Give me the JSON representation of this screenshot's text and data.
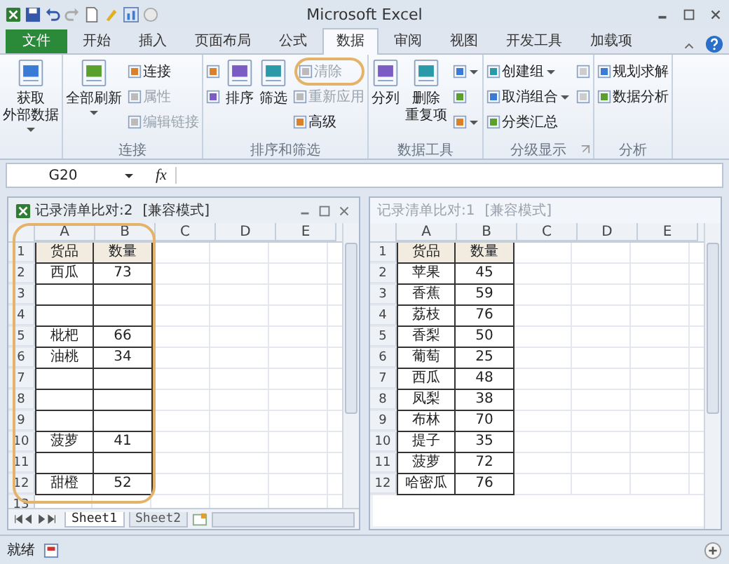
{
  "window": {
    "title": "Microsoft Excel"
  },
  "tabs": [
    {
      "label": "文件",
      "selected": false,
      "kind": "file"
    },
    {
      "label": "开始",
      "selected": false,
      "kind": "tab"
    },
    {
      "label": "插入",
      "selected": false,
      "kind": "tab"
    },
    {
      "label": "页面布局",
      "selected": false,
      "kind": "tab"
    },
    {
      "label": "公式",
      "selected": false,
      "kind": "tab"
    },
    {
      "label": "数据",
      "selected": true,
      "kind": "tab"
    },
    {
      "label": "审阅",
      "selected": false,
      "kind": "tab"
    },
    {
      "label": "视图",
      "selected": false,
      "kind": "tab"
    },
    {
      "label": "开发工具",
      "selected": false,
      "kind": "tab"
    },
    {
      "label": "加载项",
      "selected": false,
      "kind": "tab"
    }
  ],
  "ribbon": {
    "groups": [
      {
        "columns": [
          [
            {
              "kind": "large",
              "lines": [
                "获取",
                "外部数据"
              ],
              "dropdown": true,
              "disabled": false
            }
          ]
        ]
      },
      {
        "label": "连接",
        "columns": [
          [
            {
              "kind": "large",
              "lines": [
                "全部刷新"
              ],
              "dropdown": true,
              "disabled": false
            }
          ],
          [
            {
              "kind": "small",
              "label": "连接",
              "disabled": false
            },
            {
              "kind": "small",
              "label": "属性",
              "disabled": true
            },
            {
              "kind": "small",
              "label": "编辑链接",
              "disabled": true
            }
          ]
        ]
      },
      {
        "label": "排序和筛选",
        "columns": [
          [
            {
              "kind": "icon",
              "disabled": false
            },
            {
              "kind": "icon",
              "disabled": false
            }
          ],
          [
            {
              "kind": "large",
              "lines": [
                "排序"
              ],
              "disabled": false
            }
          ],
          [
            {
              "kind": "large",
              "lines": [
                "筛选"
              ],
              "disabled": false
            }
          ],
          [
            {
              "kind": "small",
              "label": "清除",
              "disabled": true,
              "circled": true
            },
            {
              "kind": "small",
              "label": "重新应用",
              "disabled": true
            },
            {
              "kind": "small",
              "label": "高级",
              "disabled": false
            }
          ]
        ]
      },
      {
        "label": "数据工具",
        "columns": [
          [
            {
              "kind": "large",
              "lines": [
                "分列"
              ],
              "disabled": false
            }
          ],
          [
            {
              "kind": "large",
              "lines": [
                "删除",
                "重复项"
              ],
              "disabled": false
            }
          ],
          [
            {
              "kind": "icon",
              "dropdown": true,
              "disabled": false
            },
            {
              "kind": "icon",
              "disabled": false
            },
            {
              "kind": "icon",
              "dropdown": true,
              "disabled": false
            }
          ]
        ]
      },
      {
        "label": "分级显示",
        "launcher": true,
        "columns": [
          [
            {
              "kind": "small",
              "label": "创建组",
              "dropdown": true,
              "disabled": false
            },
            {
              "kind": "small",
              "label": "取消组合",
              "dropdown": true,
              "disabled": false
            },
            {
              "kind": "small",
              "label": "分类汇总",
              "disabled": false
            }
          ],
          [
            {
              "kind": "icon",
              "disabled": true
            },
            {
              "kind": "icon",
              "disabled": true
            }
          ]
        ]
      },
      {
        "label": "分析",
        "columns": [
          [
            {
              "kind": "small",
              "label": "规划求解",
              "disabled": false
            },
            {
              "kind": "small",
              "label": "数据分析",
              "disabled": false
            }
          ]
        ]
      }
    ]
  },
  "formula_bar": {
    "name_box": "G20",
    "function_label": "fx"
  },
  "workbooks": [
    {
      "title": "记录清单比对:2",
      "mode": "[兼容模式]",
      "active": true,
      "circled": true,
      "columns": [
        "A",
        "B",
        "C",
        "D",
        "E"
      ],
      "rows": [
        {
          "num": "1",
          "kind": "header",
          "cells": [
            "货品",
            "数量"
          ]
        },
        {
          "num": "2",
          "kind": "record",
          "cells": [
            "西瓜",
            "73"
          ]
        },
        {
          "num": "3",
          "kind": "record",
          "cells": []
        },
        {
          "num": "4",
          "kind": "record",
          "cells": []
        },
        {
          "num": "5",
          "kind": "record",
          "cells": [
            "枇杷",
            "66"
          ]
        },
        {
          "num": "6",
          "kind": "record",
          "cells": [
            "油桃",
            "34"
          ]
        },
        {
          "num": "7",
          "kind": "record",
          "cells": []
        },
        {
          "num": "8",
          "kind": "record",
          "cells": []
        },
        {
          "num": "9",
          "kind": "record",
          "cells": []
        },
        {
          "num": "10",
          "kind": "record",
          "cells": [
            "菠萝",
            "41"
          ]
        },
        {
          "num": "11",
          "kind": "record",
          "cells": []
        },
        {
          "num": "12",
          "kind": "record",
          "cells": [
            "甜橙",
            "52"
          ]
        },
        {
          "num": "13",
          "kind": "outside",
          "cells": []
        }
      ],
      "sheets": [
        {
          "label": "Sheet1",
          "selected": true
        },
        {
          "label": "Sheet2",
          "selected": false
        }
      ]
    },
    {
      "title": "记录清单比对:1",
      "mode": "[兼容模式]",
      "active": false,
      "circled": false,
      "columns": [
        "A",
        "B",
        "C",
        "D",
        "E"
      ],
      "rows": [
        {
          "num": "1",
          "kind": "header",
          "cells": [
            "货品",
            "数量"
          ]
        },
        {
          "num": "2",
          "kind": "record",
          "cells": [
            "苹果",
            "45"
          ]
        },
        {
          "num": "3",
          "kind": "record",
          "cells": [
            "香蕉",
            "59"
          ]
        },
        {
          "num": "4",
          "kind": "record",
          "cells": [
            "荔枝",
            "76"
          ]
        },
        {
          "num": "5",
          "kind": "record",
          "cells": [
            "香梨",
            "50"
          ]
        },
        {
          "num": "6",
          "kind": "record",
          "cells": [
            "葡萄",
            "25"
          ]
        },
        {
          "num": "7",
          "kind": "record",
          "cells": [
            "西瓜",
            "48"
          ]
        },
        {
          "num": "8",
          "kind": "record",
          "cells": [
            "凤梨",
            "38"
          ]
        },
        {
          "num": "9",
          "kind": "record",
          "cells": [
            "布林",
            "70"
          ]
        },
        {
          "num": "10",
          "kind": "record",
          "cells": [
            "提子",
            "35"
          ]
        },
        {
          "num": "11",
          "kind": "record",
          "cells": [
            "菠萝",
            "72"
          ]
        },
        {
          "num": "12",
          "kind": "record",
          "cells": [
            "哈密瓜",
            "76"
          ]
        }
      ]
    }
  ],
  "status_bar": {
    "text": "就绪"
  }
}
